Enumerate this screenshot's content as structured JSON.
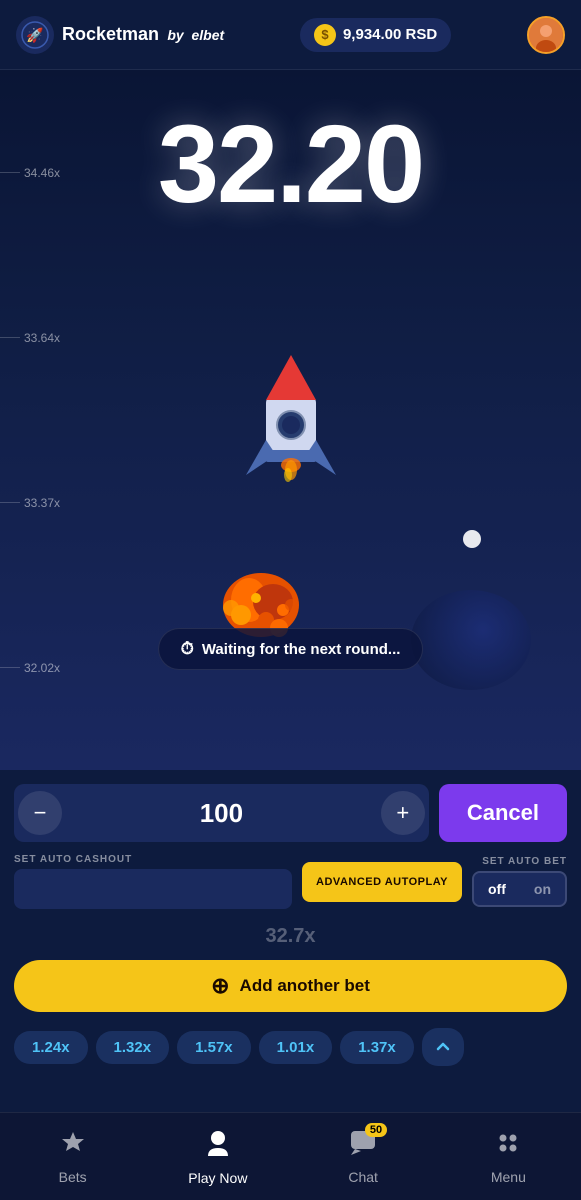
{
  "header": {
    "logo_icon": "🚀",
    "title": "Rocketman",
    "subtitle_by": "by",
    "subtitle_brand": "elbet",
    "balance": "9,934.00 RSD",
    "coin_symbol": "$"
  },
  "game": {
    "multiplier": "32.20",
    "scale_markers": [
      {
        "value": "34.46x"
      },
      {
        "value": "33.64x"
      },
      {
        "value": "33.37x"
      },
      {
        "value": "32.02x"
      }
    ],
    "waiting_text": "Waiting for the next round..."
  },
  "controls": {
    "bet_value": "100",
    "minus_label": "−",
    "plus_label": "+",
    "cancel_label": "Cancel",
    "auto_cashout_label": "SET AUTO CASHOUT",
    "auto_cashout_placeholder": "",
    "advanced_autoplay_label": "ADVANCED AUTOPLAY",
    "auto_bet_label": "SET AUTO BET",
    "toggle_off": "off",
    "toggle_on": "on",
    "prev_mult": "32.7x",
    "add_bet_label": "Add another bet"
  },
  "history": {
    "pills": [
      "1.24x",
      "1.32x",
      "1.57x",
      "1.01x",
      "1.37x"
    ]
  },
  "nav": {
    "items": [
      {
        "label": "Bets",
        "icon": "🏆",
        "active": false
      },
      {
        "label": "Play Now",
        "icon": "👤",
        "active": true
      },
      {
        "label": "Chat",
        "icon": "💬",
        "active": false,
        "badge": "50"
      },
      {
        "label": "Menu",
        "icon": "⠿",
        "active": false
      }
    ]
  }
}
